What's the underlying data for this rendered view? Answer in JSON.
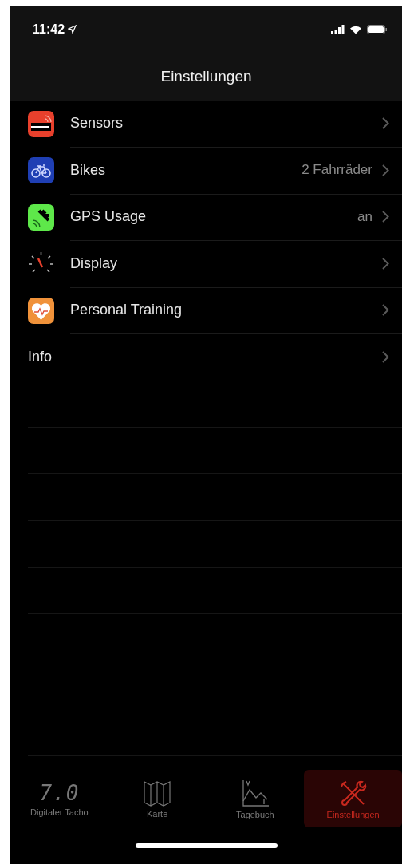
{
  "status_bar": {
    "time": "11:42"
  },
  "nav": {
    "title": "Einstellungen"
  },
  "rows": [
    {
      "kind": "sensor",
      "label": "Sensors"
    },
    {
      "kind": "bike",
      "label": "Bikes",
      "detail": "2 Fahrräder"
    },
    {
      "kind": "gps",
      "label": "GPS Usage",
      "detail": "an"
    },
    {
      "kind": "gauge",
      "label": "Display"
    },
    {
      "kind": "heart",
      "label": "Personal Training"
    },
    {
      "kind": "plain",
      "label": "Info"
    }
  ],
  "tabs": [
    {
      "kind": "tacho",
      "label": "Digitaler Tacho",
      "icon_text": "7.0",
      "selected": false
    },
    {
      "kind": "map",
      "label": "Karte",
      "selected": false
    },
    {
      "kind": "diary",
      "label": "Tagebuch",
      "selected": false
    },
    {
      "kind": "tools",
      "label": "Einstellungen",
      "selected": true
    }
  ]
}
